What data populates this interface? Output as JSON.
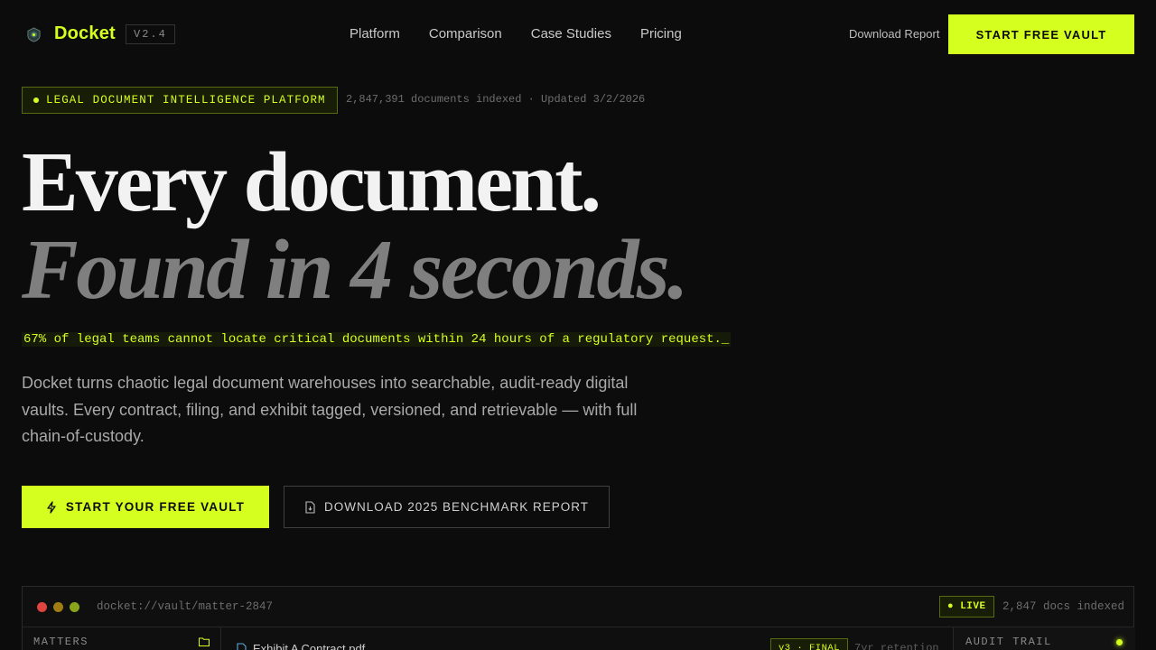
{
  "brand": {
    "name": "Docket",
    "version": "V2.4",
    "accent": "#d4ff1f",
    "background": "#0c0c0c"
  },
  "nav": {
    "links": [
      "Platform",
      "Comparison",
      "Case Studies",
      "Pricing"
    ],
    "download_label": "Download Report",
    "cta_label": "START FREE VAULT"
  },
  "hero": {
    "badge": "LEGAL DOCUMENT INTELLIGENCE PLATFORM",
    "meta": "2,847,391 documents indexed · Updated 3/2/2026",
    "headline_line1": "Every document.",
    "headline_line2": "Found in 4 seconds.",
    "stat": "67% of legal teams cannot locate critical documents within 24 hours of a regulatory request._",
    "lede": "Docket turns chaotic legal document warehouses into searchable, audit-ready digital vaults. Every contract, filing, and exhibit tagged, versioned, and retrievable — with full chain-of-custody.",
    "primary_cta": "START YOUR FREE VAULT",
    "secondary_cta": "DOWNLOAD 2025 BENCHMARK REPORT"
  },
  "preview": {
    "path": "docket://vault/matter-2847",
    "live_label": "● LIVE",
    "docs_count": "2,847 docs indexed",
    "sidebar_label": "MATTERS",
    "file_name": "Exhibit A Contract.pdf",
    "version_badge": "v3 · FINAL",
    "retention": "7yr retention",
    "audit_label": "AUDIT TRAIL",
    "traffic_lights": [
      "#e0443e",
      "#a07d12",
      "#8aa51a"
    ]
  },
  "icons": {
    "logo": "shield-logo-icon",
    "primary_cta": "bolt-icon",
    "secondary_cta": "document-icon",
    "sidebar": "folder-icon",
    "file": "file-icon"
  }
}
